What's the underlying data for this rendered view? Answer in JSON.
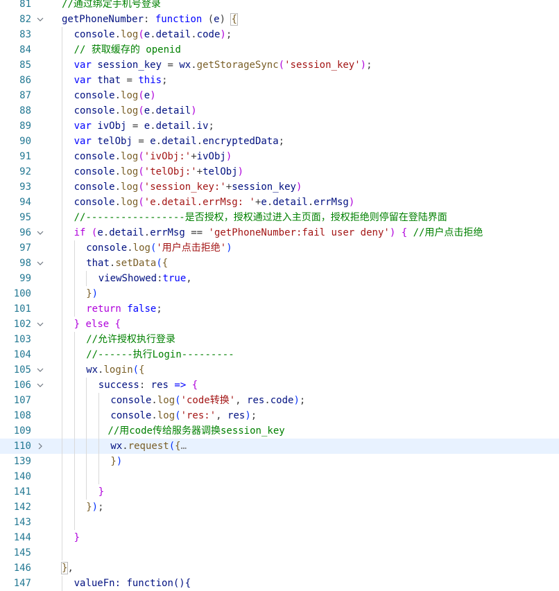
{
  "editor": {
    "lines": [
      {
        "num": "81",
        "fold": "",
        "active": false,
        "indent": 0,
        "tokens": [
          {
            "t": "//通过绑定手机号登录",
            "c": "c"
          }
        ]
      },
      {
        "num": "82",
        "fold": "open",
        "active": false,
        "indent": 0,
        "tokens": [
          {
            "t": "getPhoneNumber",
            "c": "v"
          },
          {
            "t": ": "
          },
          {
            "t": "function",
            "c": "k"
          },
          {
            "t": " ("
          },
          {
            "t": "e",
            "c": "v"
          },
          {
            "t": ") "
          },
          {
            "t": "{",
            "c": "b1",
            "m": true
          }
        ]
      },
      {
        "num": "83",
        "fold": "",
        "active": false,
        "indent": 1,
        "tokens": [
          {
            "t": "console",
            "c": "v"
          },
          {
            "t": "."
          },
          {
            "t": "log",
            "c": "f"
          },
          {
            "t": "(",
            "c": "b2"
          },
          {
            "t": "e",
            "c": "v"
          },
          {
            "t": "."
          },
          {
            "t": "detail",
            "c": "v"
          },
          {
            "t": "."
          },
          {
            "t": "code",
            "c": "v"
          },
          {
            "t": ")",
            "c": "b2"
          },
          {
            "t": ";"
          }
        ]
      },
      {
        "num": "84",
        "fold": "",
        "active": false,
        "indent": 1,
        "tokens": [
          {
            "t": "// 获取缓存的 openid",
            "c": "c"
          }
        ]
      },
      {
        "num": "85",
        "fold": "",
        "active": false,
        "indent": 1,
        "tokens": [
          {
            "t": "var",
            "c": "k"
          },
          {
            "t": " "
          },
          {
            "t": "session_key",
            "c": "v"
          },
          {
            "t": " = "
          },
          {
            "t": "wx",
            "c": "v"
          },
          {
            "t": "."
          },
          {
            "t": "getStorageSync",
            "c": "f"
          },
          {
            "t": "(",
            "c": "b2"
          },
          {
            "t": "'session_key'",
            "c": "s"
          },
          {
            "t": ")",
            "c": "b2"
          },
          {
            "t": ";"
          }
        ]
      },
      {
        "num": "86",
        "fold": "",
        "active": false,
        "indent": 1,
        "tokens": [
          {
            "t": "var",
            "c": "k"
          },
          {
            "t": " "
          },
          {
            "t": "that",
            "c": "v"
          },
          {
            "t": " = "
          },
          {
            "t": "this",
            "c": "k"
          },
          {
            "t": ";"
          }
        ]
      },
      {
        "num": "87",
        "fold": "",
        "active": false,
        "indent": 1,
        "tokens": [
          {
            "t": "console",
            "c": "v"
          },
          {
            "t": "."
          },
          {
            "t": "log",
            "c": "f"
          },
          {
            "t": "(",
            "c": "b2"
          },
          {
            "t": "e",
            "c": "v"
          },
          {
            "t": ")",
            "c": "b2"
          }
        ]
      },
      {
        "num": "88",
        "fold": "",
        "active": false,
        "indent": 1,
        "tokens": [
          {
            "t": "console",
            "c": "v"
          },
          {
            "t": "."
          },
          {
            "t": "log",
            "c": "f"
          },
          {
            "t": "(",
            "c": "b2"
          },
          {
            "t": "e",
            "c": "v"
          },
          {
            "t": "."
          },
          {
            "t": "detail",
            "c": "v"
          },
          {
            "t": ")",
            "c": "b2"
          }
        ]
      },
      {
        "num": "89",
        "fold": "",
        "active": false,
        "indent": 1,
        "tokens": [
          {
            "t": "var",
            "c": "k"
          },
          {
            "t": " "
          },
          {
            "t": "ivObj",
            "c": "v"
          },
          {
            "t": " = "
          },
          {
            "t": "e",
            "c": "v"
          },
          {
            "t": "."
          },
          {
            "t": "detail",
            "c": "v"
          },
          {
            "t": "."
          },
          {
            "t": "iv",
            "c": "v"
          },
          {
            "t": ";"
          }
        ]
      },
      {
        "num": "90",
        "fold": "",
        "active": false,
        "indent": 1,
        "tokens": [
          {
            "t": "var",
            "c": "k"
          },
          {
            "t": " "
          },
          {
            "t": "telObj",
            "c": "v"
          },
          {
            "t": " = "
          },
          {
            "t": "e",
            "c": "v"
          },
          {
            "t": "."
          },
          {
            "t": "detail",
            "c": "v"
          },
          {
            "t": "."
          },
          {
            "t": "encryptedData",
            "c": "v"
          },
          {
            "t": ";"
          }
        ]
      },
      {
        "num": "91",
        "fold": "",
        "active": false,
        "indent": 1,
        "tokens": [
          {
            "t": "console",
            "c": "v"
          },
          {
            "t": "."
          },
          {
            "t": "log",
            "c": "f"
          },
          {
            "t": "(",
            "c": "b2"
          },
          {
            "t": "'ivObj:'",
            "c": "s"
          },
          {
            "t": "+"
          },
          {
            "t": "ivObj",
            "c": "v"
          },
          {
            "t": ")",
            "c": "b2"
          }
        ]
      },
      {
        "num": "92",
        "fold": "",
        "active": false,
        "indent": 1,
        "tokens": [
          {
            "t": "console",
            "c": "v"
          },
          {
            "t": "."
          },
          {
            "t": "log",
            "c": "f"
          },
          {
            "t": "(",
            "c": "b2"
          },
          {
            "t": "'telObj:'",
            "c": "s"
          },
          {
            "t": "+"
          },
          {
            "t": "telObj",
            "c": "v"
          },
          {
            "t": ")",
            "c": "b2"
          }
        ]
      },
      {
        "num": "93",
        "fold": "",
        "active": false,
        "indent": 1,
        "tokens": [
          {
            "t": "console",
            "c": "v"
          },
          {
            "t": "."
          },
          {
            "t": "log",
            "c": "f"
          },
          {
            "t": "(",
            "c": "b2"
          },
          {
            "t": "'session_key:'",
            "c": "s"
          },
          {
            "t": "+"
          },
          {
            "t": "session_key",
            "c": "v"
          },
          {
            "t": ")",
            "c": "b2"
          }
        ]
      },
      {
        "num": "94",
        "fold": "",
        "active": false,
        "indent": 1,
        "tokens": [
          {
            "t": "console",
            "c": "v"
          },
          {
            "t": "."
          },
          {
            "t": "log",
            "c": "f"
          },
          {
            "t": "(",
            "c": "b2"
          },
          {
            "t": "'e.detail.errMsg: '",
            "c": "s"
          },
          {
            "t": "+"
          },
          {
            "t": "e",
            "c": "v"
          },
          {
            "t": "."
          },
          {
            "t": "detail",
            "c": "v"
          },
          {
            "t": "."
          },
          {
            "t": "errMsg",
            "c": "v"
          },
          {
            "t": ")",
            "c": "b2"
          }
        ]
      },
      {
        "num": "95",
        "fold": "",
        "active": false,
        "indent": 1,
        "tokens": [
          {
            "t": "//-----------------是否授权，授权通过进入主页面，授权拒绝则停留在登陆界面",
            "c": "c"
          }
        ]
      },
      {
        "num": "96",
        "fold": "open",
        "active": false,
        "indent": 1,
        "tokens": [
          {
            "t": "if",
            "c": "ck"
          },
          {
            "t": " "
          },
          {
            "t": "(",
            "c": "b2"
          },
          {
            "t": "e",
            "c": "v"
          },
          {
            "t": "."
          },
          {
            "t": "detail",
            "c": "v"
          },
          {
            "t": "."
          },
          {
            "t": "errMsg",
            "c": "v"
          },
          {
            "t": " == "
          },
          {
            "t": "'getPhoneNumber:fail user deny'",
            "c": "s"
          },
          {
            "t": ")",
            "c": "b2"
          },
          {
            "t": " "
          },
          {
            "t": "{",
            "c": "b2"
          },
          {
            "t": " "
          },
          {
            "t": "//用户点击拒绝",
            "c": "c"
          }
        ]
      },
      {
        "num": "97",
        "fold": "",
        "active": false,
        "indent": 2,
        "tokens": [
          {
            "t": "console",
            "c": "v"
          },
          {
            "t": "."
          },
          {
            "t": "log",
            "c": "f"
          },
          {
            "t": "(",
            "c": "b3"
          },
          {
            "t": "'用户点击拒绝'",
            "c": "s"
          },
          {
            "t": ")",
            "c": "b3"
          }
        ]
      },
      {
        "num": "98",
        "fold": "open",
        "active": false,
        "indent": 2,
        "tokens": [
          {
            "t": "that",
            "c": "v"
          },
          {
            "t": "."
          },
          {
            "t": "setData",
            "c": "f"
          },
          {
            "t": "(",
            "c": "b3"
          },
          {
            "t": "{",
            "c": "b1"
          }
        ]
      },
      {
        "num": "99",
        "fold": "",
        "active": false,
        "indent": 3,
        "tokens": [
          {
            "t": "viewShowed",
            "c": "v"
          },
          {
            "t": ":"
          },
          {
            "t": "true",
            "c": "k"
          },
          {
            "t": ","
          }
        ]
      },
      {
        "num": "100",
        "fold": "",
        "active": false,
        "indent": 2,
        "tokens": [
          {
            "t": "}",
            "c": "b1"
          },
          {
            "t": ")",
            "c": "b3"
          }
        ]
      },
      {
        "num": "101",
        "fold": "",
        "active": false,
        "indent": 2,
        "tokens": [
          {
            "t": "return",
            "c": "ck"
          },
          {
            "t": " "
          },
          {
            "t": "false",
            "c": "k"
          },
          {
            "t": ";"
          }
        ]
      },
      {
        "num": "102",
        "fold": "open",
        "active": false,
        "indent": 1,
        "tokens": [
          {
            "t": "}",
            "c": "b2"
          },
          {
            "t": " "
          },
          {
            "t": "else",
            "c": "ck"
          },
          {
            "t": " "
          },
          {
            "t": "{",
            "c": "b2"
          }
        ]
      },
      {
        "num": "103",
        "fold": "",
        "active": false,
        "indent": 2,
        "tokens": [
          {
            "t": "//允许授权执行登录",
            "c": "c"
          }
        ]
      },
      {
        "num": "104",
        "fold": "",
        "active": false,
        "indent": 2,
        "tokens": [
          {
            "t": "//------执行Login---------",
            "c": "c"
          }
        ]
      },
      {
        "num": "105",
        "fold": "open",
        "active": false,
        "indent": 2,
        "tokens": [
          {
            "t": "wx",
            "c": "v"
          },
          {
            "t": "."
          },
          {
            "t": "login",
            "c": "f"
          },
          {
            "t": "(",
            "c": "b3"
          },
          {
            "t": "{",
            "c": "b1"
          }
        ]
      },
      {
        "num": "106",
        "fold": "open",
        "active": false,
        "indent": 3,
        "tokens": [
          {
            "t": "success",
            "c": "v"
          },
          {
            "t": ": "
          },
          {
            "t": "res",
            "c": "v"
          },
          {
            "t": " "
          },
          {
            "t": "=>",
            "c": "k"
          },
          {
            "t": " "
          },
          {
            "t": "{",
            "c": "b2"
          }
        ]
      },
      {
        "num": "107",
        "fold": "",
        "active": false,
        "indent": 4,
        "tokens": [
          {
            "t": "console",
            "c": "v"
          },
          {
            "t": "."
          },
          {
            "t": "log",
            "c": "f"
          },
          {
            "t": "(",
            "c": "b3"
          },
          {
            "t": "'code转换'",
            "c": "s"
          },
          {
            "t": ", "
          },
          {
            "t": "res",
            "c": "v"
          },
          {
            "t": "."
          },
          {
            "t": "code",
            "c": "v"
          },
          {
            "t": ")",
            "c": "b3"
          },
          {
            "t": ";"
          }
        ]
      },
      {
        "num": "108",
        "fold": "",
        "active": false,
        "indent": 4,
        "tokens": [
          {
            "t": "console",
            "c": "v"
          },
          {
            "t": "."
          },
          {
            "t": "log",
            "c": "f"
          },
          {
            "t": "(",
            "c": "b3"
          },
          {
            "t": "'res:'",
            "c": "s"
          },
          {
            "t": ", "
          },
          {
            "t": "res",
            "c": "v"
          },
          {
            "t": ")",
            "c": "b3"
          },
          {
            "t": ";"
          }
        ]
      },
      {
        "num": "109",
        "fold": "",
        "active": false,
        "indent": 4,
        "shift": -4,
        "tokens": [
          {
            "t": "//用code传给服务器调换session_key",
            "c": "c"
          }
        ]
      },
      {
        "num": "110",
        "fold": "closed",
        "active": true,
        "indent": 4,
        "tokens": [
          {
            "t": "wx",
            "c": "v"
          },
          {
            "t": "."
          },
          {
            "t": "request",
            "c": "f"
          },
          {
            "t": "(",
            "c": "b3"
          },
          {
            "t": "{",
            "c": "b1"
          },
          {
            "t": "…",
            "c": "ell"
          }
        ]
      },
      {
        "num": "139",
        "fold": "",
        "active": false,
        "indent": 4,
        "tokens": [
          {
            "t": "}",
            "c": "b1"
          },
          {
            "t": ")",
            "c": "b3"
          }
        ]
      },
      {
        "num": "140",
        "fold": "",
        "active": false,
        "indent": 4,
        "tokens": []
      },
      {
        "num": "141",
        "fold": "",
        "active": false,
        "indent": 3,
        "tokens": [
          {
            "t": "}",
            "c": "b2"
          }
        ]
      },
      {
        "num": "142",
        "fold": "",
        "active": false,
        "indent": 2,
        "tokens": [
          {
            "t": "}",
            "c": "b1"
          },
          {
            "t": ")",
            "c": "b3"
          },
          {
            "t": ";"
          }
        ]
      },
      {
        "num": "143",
        "fold": "",
        "active": false,
        "indent": 2,
        "tokens": []
      },
      {
        "num": "144",
        "fold": "",
        "active": false,
        "indent": 1,
        "tokens": [
          {
            "t": "}",
            "c": "b2"
          }
        ]
      },
      {
        "num": "145",
        "fold": "",
        "active": false,
        "indent": 1,
        "tokens": []
      },
      {
        "num": "146",
        "fold": "",
        "active": false,
        "indent": 0,
        "tokens": [
          {
            "t": "}",
            "c": "b1",
            "m": true
          },
          {
            "t": ","
          }
        ]
      },
      {
        "num": "147",
        "fold": "",
        "active": false,
        "indent": 1,
        "tokens": [
          {
            "t": "valueFn: function(){",
            "c": "v"
          }
        ]
      }
    ]
  }
}
